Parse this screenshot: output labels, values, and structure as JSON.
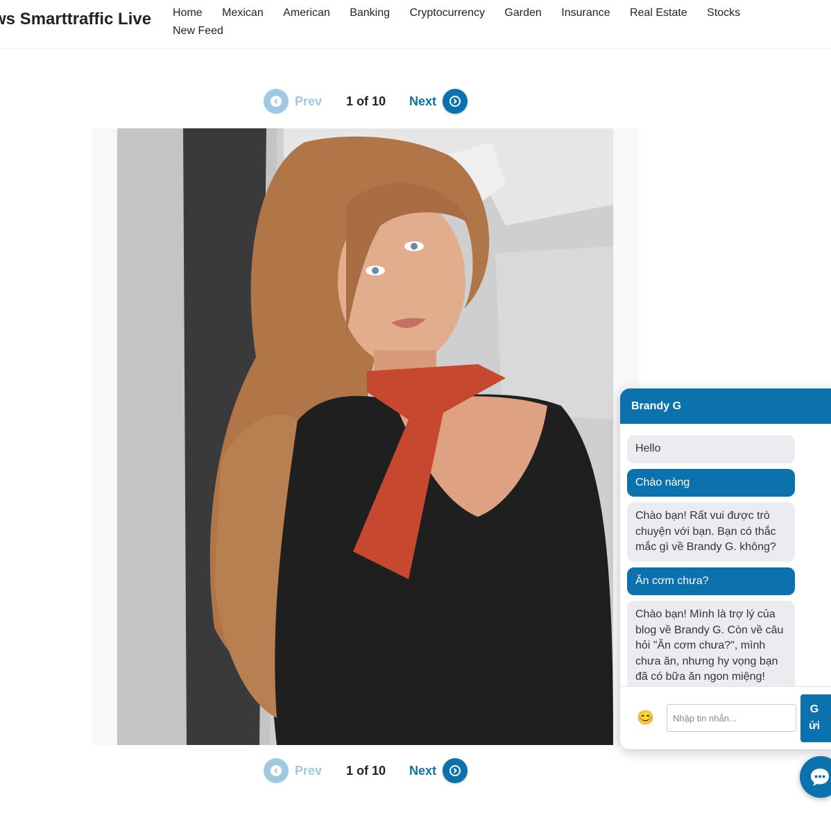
{
  "header": {
    "site_title": "ws Smarttraffic Live",
    "nav": [
      "Home",
      "Mexican",
      "American",
      "Banking",
      "Cryptocurrency",
      "Garden",
      "Insurance",
      "Real Estate",
      "Stocks",
      "New Feed"
    ]
  },
  "pager": {
    "prev_label": "Prev",
    "next_label": "Next",
    "count": "1 of 10"
  },
  "chat": {
    "title": "Brandy G",
    "messages": [
      {
        "role": "bot",
        "text": "Hello"
      },
      {
        "role": "user",
        "text": "Chào nàng"
      },
      {
        "role": "bot",
        "text": "Chào bạn! Rất vui được trò chuyện với bạn. Bạn có thắc mắc gì về Brandy G. không?"
      },
      {
        "role": "user",
        "text": "Ăn cơm chưa?"
      },
      {
        "role": "bot",
        "text": "Chào bạn! Mình là trợ lý của blog về Brandy G. Còn về câu hỏi \"Ăn cơm chưa?\", mình chưa ăn, nhưng hy vọng bạn đã có bữa ăn ngon miệng! Nếu bạn cần thông tin gì về"
      }
    ],
    "input_placeholder": "Nhập tin nhắn...",
    "send_label": "Gửi",
    "emoji": "😊"
  },
  "colors": {
    "accent": "#0b72ad",
    "accent_light": "#9fc9e3",
    "bubble_bot": "#eaecef"
  },
  "icons": {
    "prev": "chevron-left-circle-icon",
    "next": "chevron-right-circle-icon",
    "chat_fab": "chat-bubble-icon"
  }
}
